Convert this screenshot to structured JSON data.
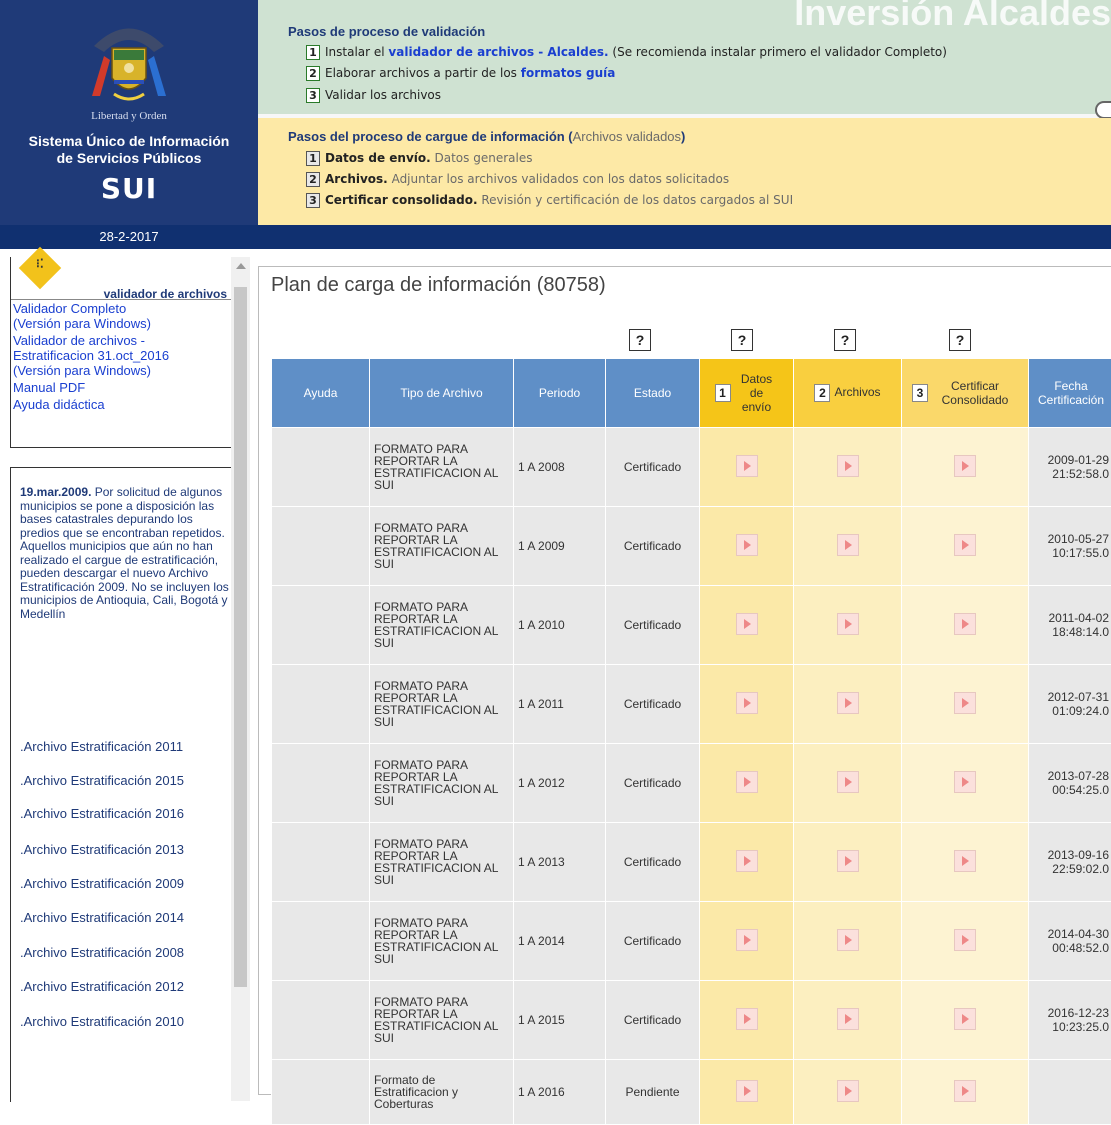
{
  "header": {
    "motto": "Libertad y Orden",
    "system_name_line1": "Sistema Único de Información",
    "system_name_line2": "de Servicios Públicos",
    "brand": "SUI",
    "date": "28-2-2017",
    "watermark": "Inversión Alcaldes",
    "validation": {
      "title": "Pasos de proceso de validación",
      "steps": [
        {
          "num": "1",
          "pre": "Instalar el ",
          "link": "validador de archivos - Alcaldes.",
          "post": " (Se recomienda instalar primero el validador Completo)"
        },
        {
          "num": "2",
          "pre": "Elaborar archivos a partir de los ",
          "link": "formatos guía",
          "post": ""
        },
        {
          "num": "3",
          "pre": "Validar los archivos",
          "link": "",
          "post": ""
        }
      ]
    },
    "upload": {
      "title_bold": "Pasos del proceso de cargue de información (",
      "title_muted": "Archivos validados",
      "title_close": ")",
      "steps": [
        {
          "num": "1",
          "bold": "Datos de envío.",
          "rest": " Datos generales"
        },
        {
          "num": "2",
          "bold": "Archivos.",
          "rest": " Adjuntar los archivos validados con los datos solicitados"
        },
        {
          "num": "3",
          "bold": "Certificar consolidado.",
          "rest": " Revisión y certificación de los datos cargados al SUI"
        }
      ]
    }
  },
  "sidebar": {
    "tools_title": "validador de archivos",
    "tools": [
      {
        "line1": "Validador Completo",
        "line2": "(Versión para Windows)"
      },
      {
        "line1": "Validador de archivos -",
        "line2": "Estratificacion 31.oct_2016",
        "line3": "(Versión para Windows)"
      },
      {
        "line1": "Manual PDF"
      },
      {
        "line1": "Ayuda didáctica"
      }
    ],
    "news_date": "19.mar.2009.",
    "news_body": " Por solicitud de algunos municipios se pone a disposición las bases catastrales depurando los predios que se encontraban repetidos. Aquellos municipios que aún no han realizado el cargue de estratificación, pueden descargar el nuevo Archivo Estratificación 2009. No se incluyen los municipios de Antioquia, Cali, Bogotá y Medellín",
    "archives": [
      ".Archivo Estratificación 2011",
      ".Archivo Estratificación 2015",
      ".Archivo Estratificación 2016",
      ".Archivo Estratificación 2013",
      ".Archivo Estratificación 2009",
      ".Archivo Estratificación 2014",
      ".Archivo Estratificación 2008",
      ".Archivo Estratificación 2012",
      ".Archivo Estratificación 2010"
    ]
  },
  "main": {
    "title": "Plan de carga de información (80758)",
    "help_symbol": "?",
    "columns": {
      "ayuda": "Ayuda",
      "tipo": "Tipo de Archivo",
      "periodo": "Periodo",
      "estado": "Estado",
      "datos_num": "1",
      "datos": "Datos de envío",
      "archivos_num": "2",
      "archivos": "Archivos",
      "cert_num": "3",
      "cert": "Certificar Consolidado",
      "fecha": "Fecha Certificación"
    },
    "rows": [
      {
        "tipo": "FORMATO PARA REPORTAR LA ESTRATIFICACION AL SUI",
        "periodo": "1 A 2008",
        "estado": "Certificado",
        "fecha_d": "2009-01-29",
        "fecha_t": "21:52:58.0"
      },
      {
        "tipo": "FORMATO PARA REPORTAR LA ESTRATIFICACION AL SUI",
        "periodo": "1 A 2009",
        "estado": "Certificado",
        "fecha_d": "2010-05-27",
        "fecha_t": "10:17:55.0"
      },
      {
        "tipo": "FORMATO PARA REPORTAR LA ESTRATIFICACION AL SUI",
        "periodo": "1 A 2010",
        "estado": "Certificado",
        "fecha_d": "2011-04-02",
        "fecha_t": "18:48:14.0"
      },
      {
        "tipo": "FORMATO PARA REPORTAR LA ESTRATIFICACION AL SUI",
        "periodo": "1 A 2011",
        "estado": "Certificado",
        "fecha_d": "2012-07-31",
        "fecha_t": "01:09:24.0"
      },
      {
        "tipo": "FORMATO PARA REPORTAR LA ESTRATIFICACION AL SUI",
        "periodo": "1 A 2012",
        "estado": "Certificado",
        "fecha_d": "2013-07-28",
        "fecha_t": "00:54:25.0"
      },
      {
        "tipo": "FORMATO PARA REPORTAR LA ESTRATIFICACION AL SUI",
        "periodo": "1 A 2013",
        "estado": "Certificado",
        "fecha_d": "2013-09-16",
        "fecha_t": "22:59:02.0"
      },
      {
        "tipo": "FORMATO PARA REPORTAR LA ESTRATIFICACION AL SUI",
        "periodo": "1 A 2014",
        "estado": "Certificado",
        "fecha_d": "2014-04-30",
        "fecha_t": "00:48:52.0"
      },
      {
        "tipo": "FORMATO PARA REPORTAR LA ESTRATIFICACION AL SUI",
        "periodo": "1 A 2015",
        "estado": "Certificado",
        "fecha_d": "2016-12-23",
        "fecha_t": "10:23:25.0"
      },
      {
        "tipo": "Formato de Estratificacion y Coberturas",
        "periodo": "1 A 2016",
        "estado": "Pendiente",
        "fecha_d": "",
        "fecha_t": ""
      }
    ]
  },
  "colors": {
    "brand_blue": "#1f3a78",
    "validation_bg": "#cfe2d2",
    "upload_bg": "#fde9a6",
    "table_header_blue": "#5f8fc7",
    "step_gold": "#f5c518"
  },
  "icons": {
    "emblem": "colombia-coat-of-arms-icon",
    "tools": "yellow-diamond-icon",
    "step_action": "play-arrow-icon",
    "help": "question-icon"
  }
}
